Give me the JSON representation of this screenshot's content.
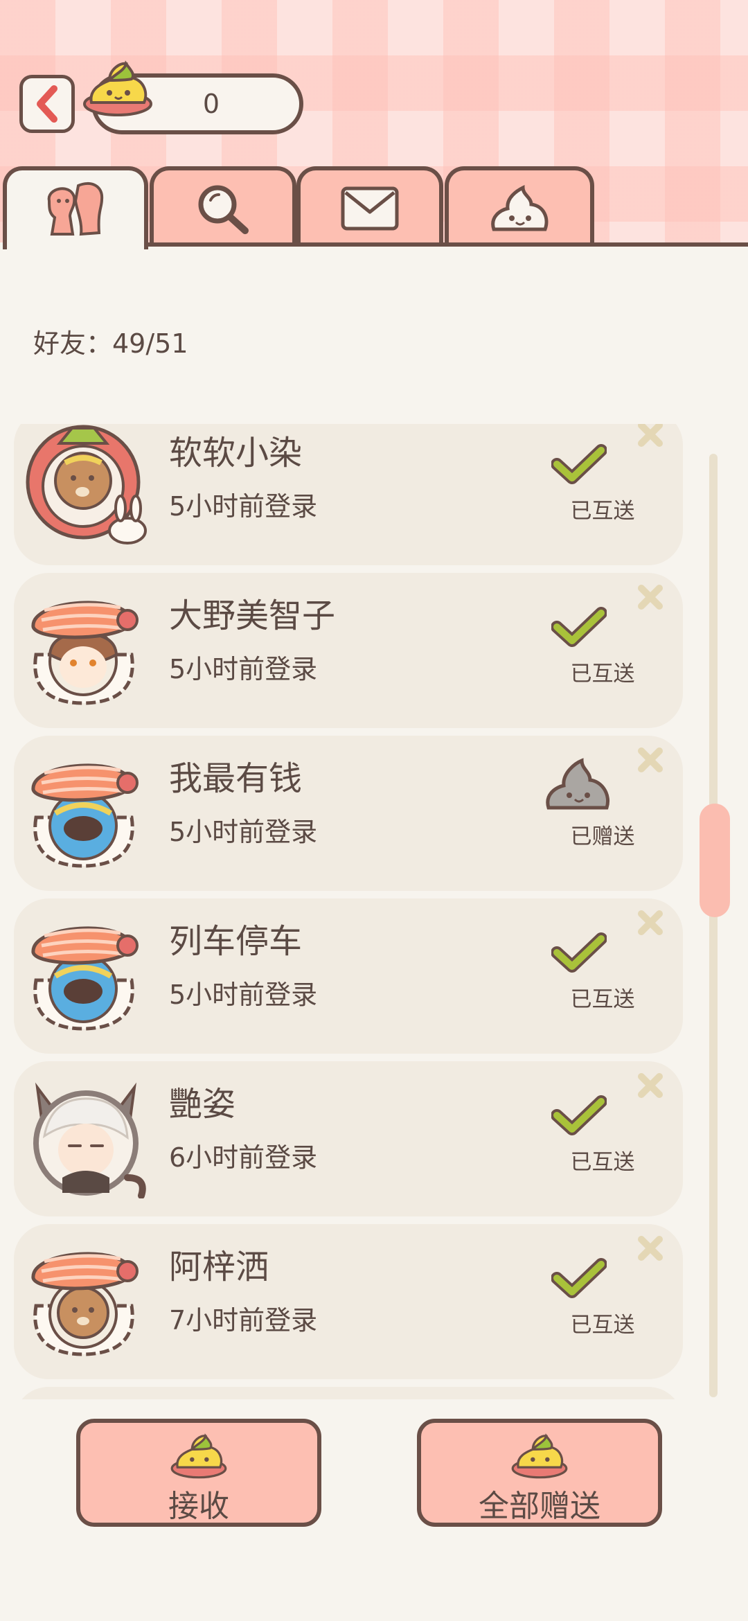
{
  "header": {
    "coin_count": "0"
  },
  "tabs": [
    {
      "icon": "friends-icon",
      "active": true
    },
    {
      "icon": "search-icon",
      "active": false
    },
    {
      "icon": "mail-icon",
      "active": false
    },
    {
      "icon": "gift-poop-icon",
      "active": false
    }
  ],
  "friends_label": "好友：49/51",
  "friends": [
    {
      "name": "软软小染",
      "login": "5小时前登录",
      "status": "已互送",
      "status_icon": "check-icon",
      "avatar": "rabbit-bear-avatar"
    },
    {
      "name": "大野美智子",
      "login": "5小时前登录",
      "status": "已互送",
      "status_icon": "check-icon",
      "avatar": "salmon-sushi-avatar"
    },
    {
      "name": "我最有钱",
      "login": "5小时前登录",
      "status": "已赠送",
      "status_icon": "gray-poop-icon",
      "avatar": "salmon-sushi-avatar"
    },
    {
      "name": "列车停车",
      "login": "5小时前登录",
      "status": "已互送",
      "status_icon": "check-icon",
      "avatar": "salmon-sushi-avatar"
    },
    {
      "name": "艷姿",
      "login": "6小时前登录",
      "status": "已互送",
      "status_icon": "check-icon",
      "avatar": "cat-ear-avatar"
    },
    {
      "name": "阿梓洒",
      "login": "7小时前登录",
      "status": "已互送",
      "status_icon": "check-icon",
      "avatar": "salmon-sushi-avatar"
    }
  ],
  "buttons": {
    "receive": "接收",
    "send_all": "全部赠送"
  },
  "colors": {
    "accent": "#fdbfb2",
    "outline": "#6a4f47",
    "check": "#a9c23a",
    "row_bg": "#f1ebe1"
  }
}
